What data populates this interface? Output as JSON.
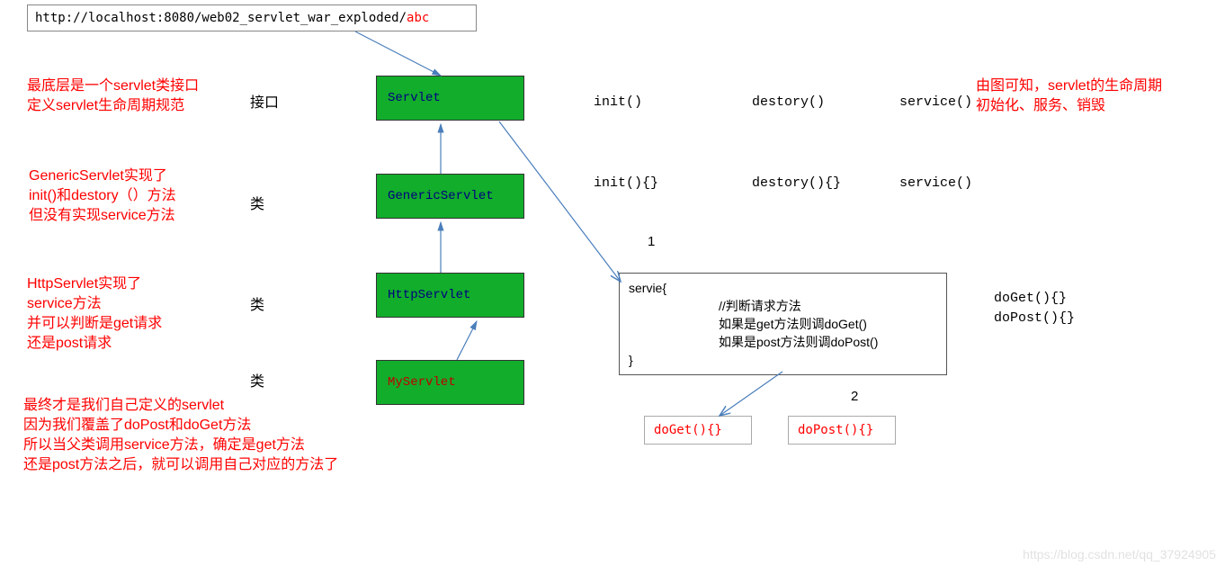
{
  "url": {
    "prefix": "http://localhost:8080/web02_servlet_war_exploded/",
    "suffix": "abc"
  },
  "notes": {
    "servlet_interface": "最底层是一个servlet类接口\n定义servlet生命周期规范",
    "generic_servlet": "GenericServlet实现了\ninit()和destory（）方法\n但没有实现service方法",
    "http_servlet": "HttpServlet实现了\nservice方法\n并可以判断是get请求\n还是post请求",
    "my_servlet": "最终才是我们自己定义的servlet\n因为我们覆盖了doPost和doGet方法\n所以当父类调用service方法，确定是get方法\n还是post方法之后，就可以调用自己对应的方法了",
    "summary": "由图可知，servlet的生命周期\n初始化、服务、销毁"
  },
  "type_labels": {
    "interface": "接口",
    "class": "类"
  },
  "boxes": {
    "servlet": "Servlet",
    "generic": "GenericServlet",
    "http": "HttpServlet",
    "my": "MyServlet"
  },
  "methods_row1": {
    "init": "init()",
    "destory": "destory()",
    "service": "service()"
  },
  "methods_row2": {
    "init": "init(){}",
    "destory": "destory(){}",
    "service": "service()"
  },
  "numbers": {
    "one": "1",
    "two": "2"
  },
  "servie_box": {
    "open": "servie{",
    "c1": "//判断请求方法",
    "c2": "如果是get方法则调doGet()",
    "c3": "如果是post方法则调doPost()",
    "close": "}"
  },
  "right_methods": {
    "doget": "doGet(){}",
    "dopost": "doPost(){}"
  },
  "bottom_boxes": {
    "doget": "doGet(){}",
    "dopost": "doPost(){}"
  },
  "watermark": "https://blog.csdn.net/qq_37924905"
}
